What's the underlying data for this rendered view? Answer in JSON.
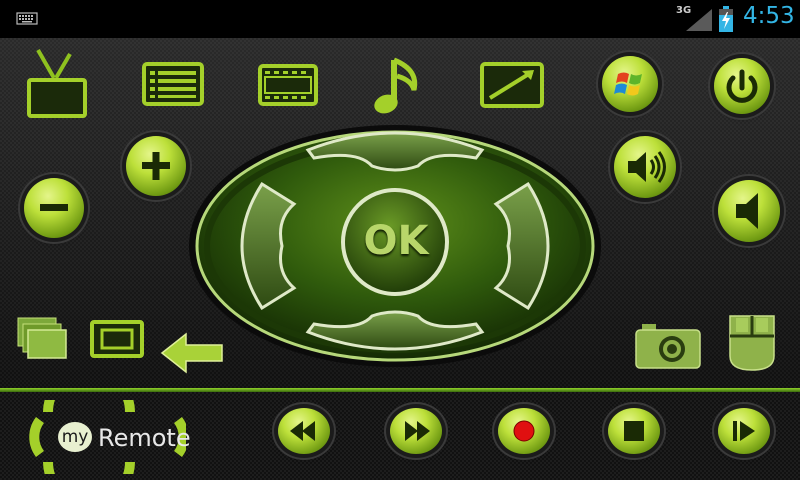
{
  "status_bar": {
    "network": "3G",
    "time": "4:53",
    "icons": [
      "keyboard-icon",
      "signal-icon",
      "battery-charging-icon"
    ]
  },
  "remote": {
    "top_row": [
      "tv-icon",
      "guide-list-icon",
      "movie-film-icon",
      "music-note-icon",
      "fullscreen-icon",
      "windows-start-icon",
      "power-icon"
    ],
    "volume_down_symbol": "−",
    "channel_up_symbol": "+",
    "ok_label": "OK",
    "accent_color": "#a7d12f",
    "dark_green": "#2e5a07"
  },
  "brand": {
    "my": "my",
    "name": "Remote"
  },
  "media_controls": [
    "rewind-icon",
    "fast-forward-icon",
    "record-icon",
    "stop-icon",
    "skip-icon"
  ]
}
